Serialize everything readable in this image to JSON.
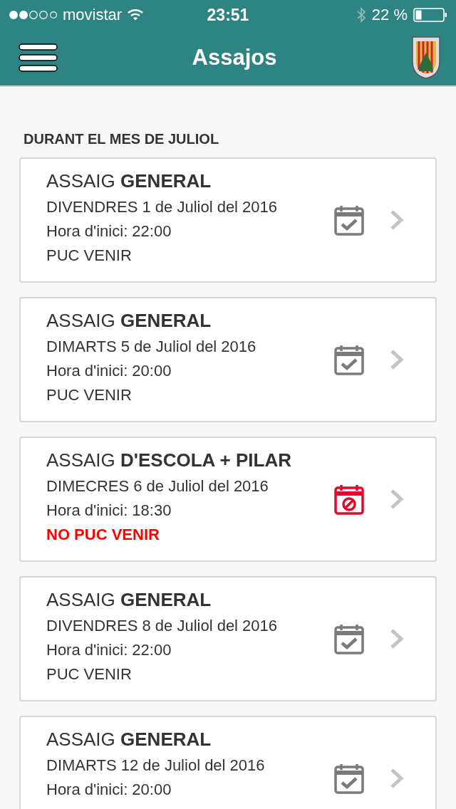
{
  "status_bar": {
    "carrier": "movistar",
    "time": "23:51",
    "battery": "22 %"
  },
  "header": {
    "title": "Assajos"
  },
  "section": {
    "title": "DURANT EL MES DE JULIOL"
  },
  "rehearsals": [
    {
      "title": "ASSAIG **GENERAL**",
      "date": "DIVENDRES 1 de Juliol del 2016",
      "start": "Hora d'inici: 22:00",
      "kind": "attending",
      "status": "PUC VENIR"
    },
    {
      "title": "ASSAIG **GENERAL**",
      "date": "DIMARTS 5 de Juliol del 2016",
      "start": "Hora d'inici: 20:00",
      "kind": "attending",
      "status": "PUC VENIR"
    },
    {
      "title": "ASSAIG **D'ESCOLA + PILAR**",
      "date": "DIMECRES 6 de Juliol del 2016",
      "start": "Hora d'inici: 18:30",
      "kind": "absent",
      "status": "NO PUC VENIR"
    },
    {
      "title": "ASSAIG **GENERAL**",
      "date": "DIVENDRES 8 de Juliol del 2016",
      "start": "Hora d'inici: 22:00",
      "kind": "attending",
      "status": "PUC VENIR"
    },
    {
      "title": "ASSAIG **GENERAL**",
      "date": "DIMARTS 12 de Juliol del 2016",
      "start": "Hora d'inici: 20:00",
      "kind": "attending"
    }
  ]
}
